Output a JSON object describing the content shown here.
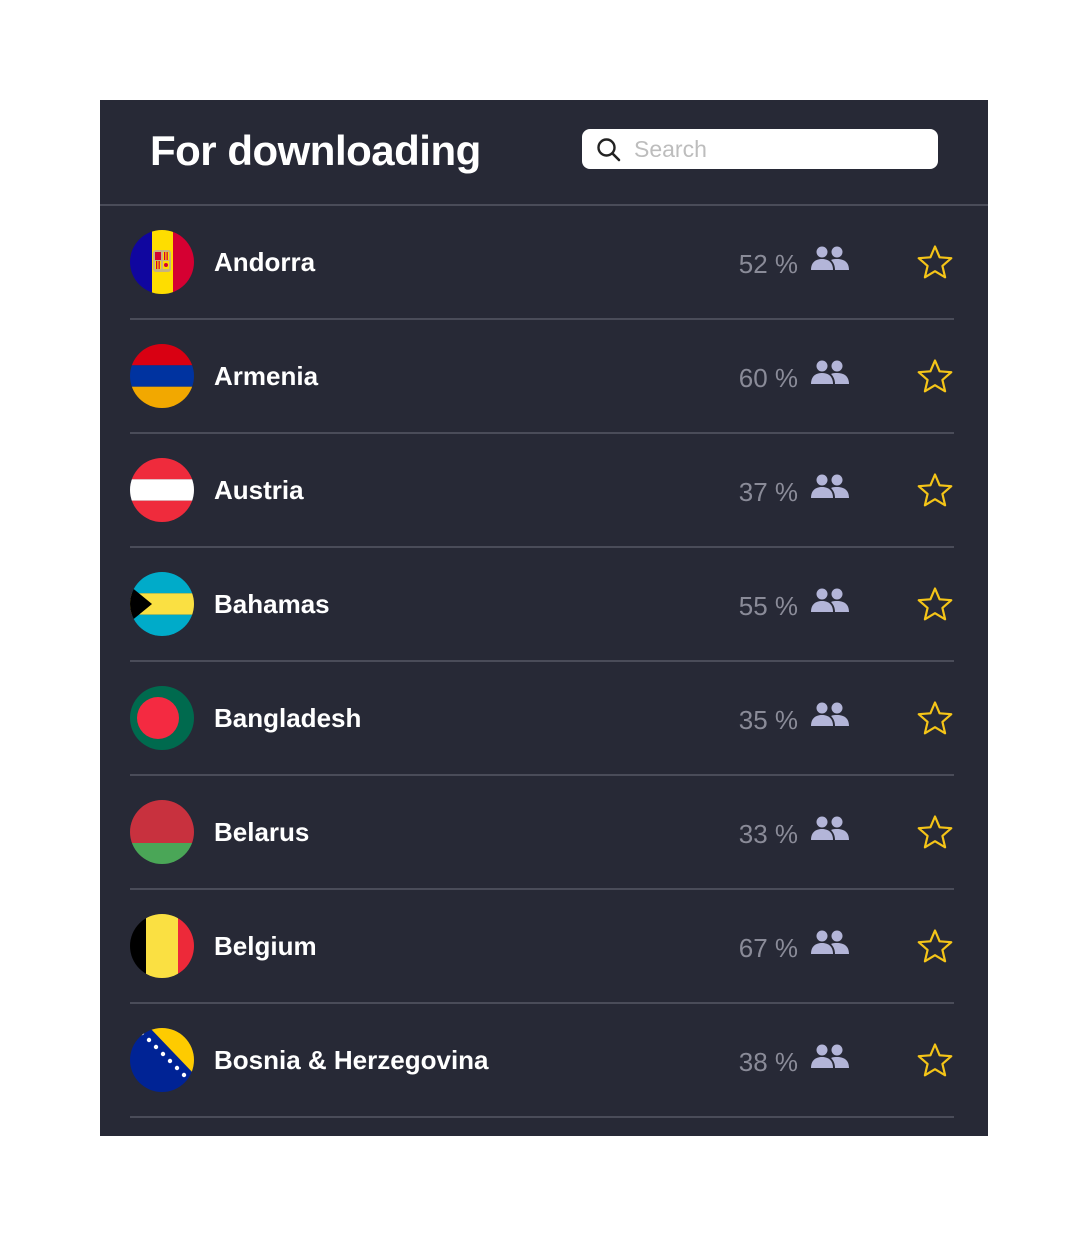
{
  "header": {
    "title": "For downloading",
    "search": {
      "placeholder": "Search",
      "value": ""
    }
  },
  "colors": {
    "panel_bg": "#272936",
    "divider": "#4a4c59",
    "percent_text": "#8a8b98",
    "people_icon": "#b3b5d8",
    "star": "#f5c518"
  },
  "icons": {
    "search": "magnifier-icon",
    "users": "people-icon",
    "favorite": "star-outline-icon"
  },
  "countries": [
    {
      "name": "Andorra",
      "percent": "52 %",
      "flag": "andorra",
      "favorite": false
    },
    {
      "name": "Armenia",
      "percent": "60 %",
      "flag": "armenia",
      "favorite": false
    },
    {
      "name": "Austria",
      "percent": "37 %",
      "flag": "austria",
      "favorite": false
    },
    {
      "name": "Bahamas",
      "percent": "55 %",
      "flag": "bahamas",
      "favorite": false
    },
    {
      "name": "Bangladesh",
      "percent": "35 %",
      "flag": "bangladesh",
      "favorite": false
    },
    {
      "name": "Belarus",
      "percent": "33 %",
      "flag": "belarus",
      "favorite": false
    },
    {
      "name": "Belgium",
      "percent": "67 %",
      "flag": "belgium",
      "favorite": false
    },
    {
      "name": "Bosnia & Herzegovina",
      "percent": "38 %",
      "flag": "bosnia",
      "favorite": false
    }
  ]
}
